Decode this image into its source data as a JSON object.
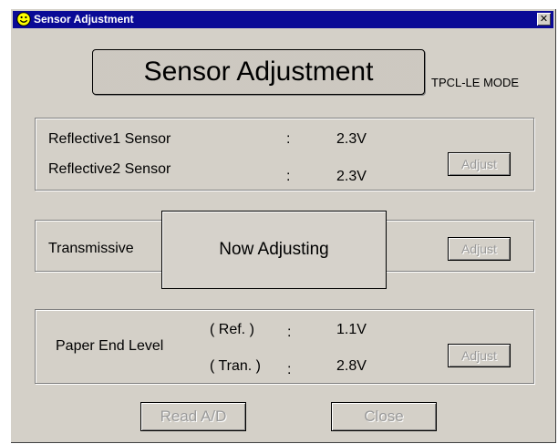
{
  "window": {
    "title": "Sensor Adjustment",
    "close_glyph": "✕"
  },
  "heading": {
    "title": "Sensor Adjustment",
    "mode": "TPCL-LE MODE"
  },
  "reflective": {
    "sensor1_label": "Reflective1 Sensor",
    "sensor1_sep": ":",
    "sensor1_value": "2.3V",
    "sensor2_label": "Reflective2 Sensor",
    "sensor2_sep": ":",
    "sensor2_value": "2.3V",
    "adjust_label": "Adjust"
  },
  "transmissive": {
    "label": "Transmissive",
    "adjust_label": "Adjust"
  },
  "overlay": {
    "text": "Now  Adjusting"
  },
  "paper_end": {
    "label": "Paper End Level",
    "ref_label": "( Ref.  )",
    "ref_sep": ":",
    "ref_value": "1.1V",
    "tran_label": "( Tran. )",
    "tran_sep": ":",
    "tran_value": "2.8V",
    "adjust_label": "Adjust"
  },
  "footer": {
    "read_ad_label": "Read A/D",
    "close_label": "Close"
  },
  "icons": {
    "app": "smiley-icon",
    "close": "close-icon"
  },
  "colors": {
    "titlebar": "#0a0a96",
    "dialog": "#d4d0c8",
    "disabled_text": "#9a9a9a"
  }
}
